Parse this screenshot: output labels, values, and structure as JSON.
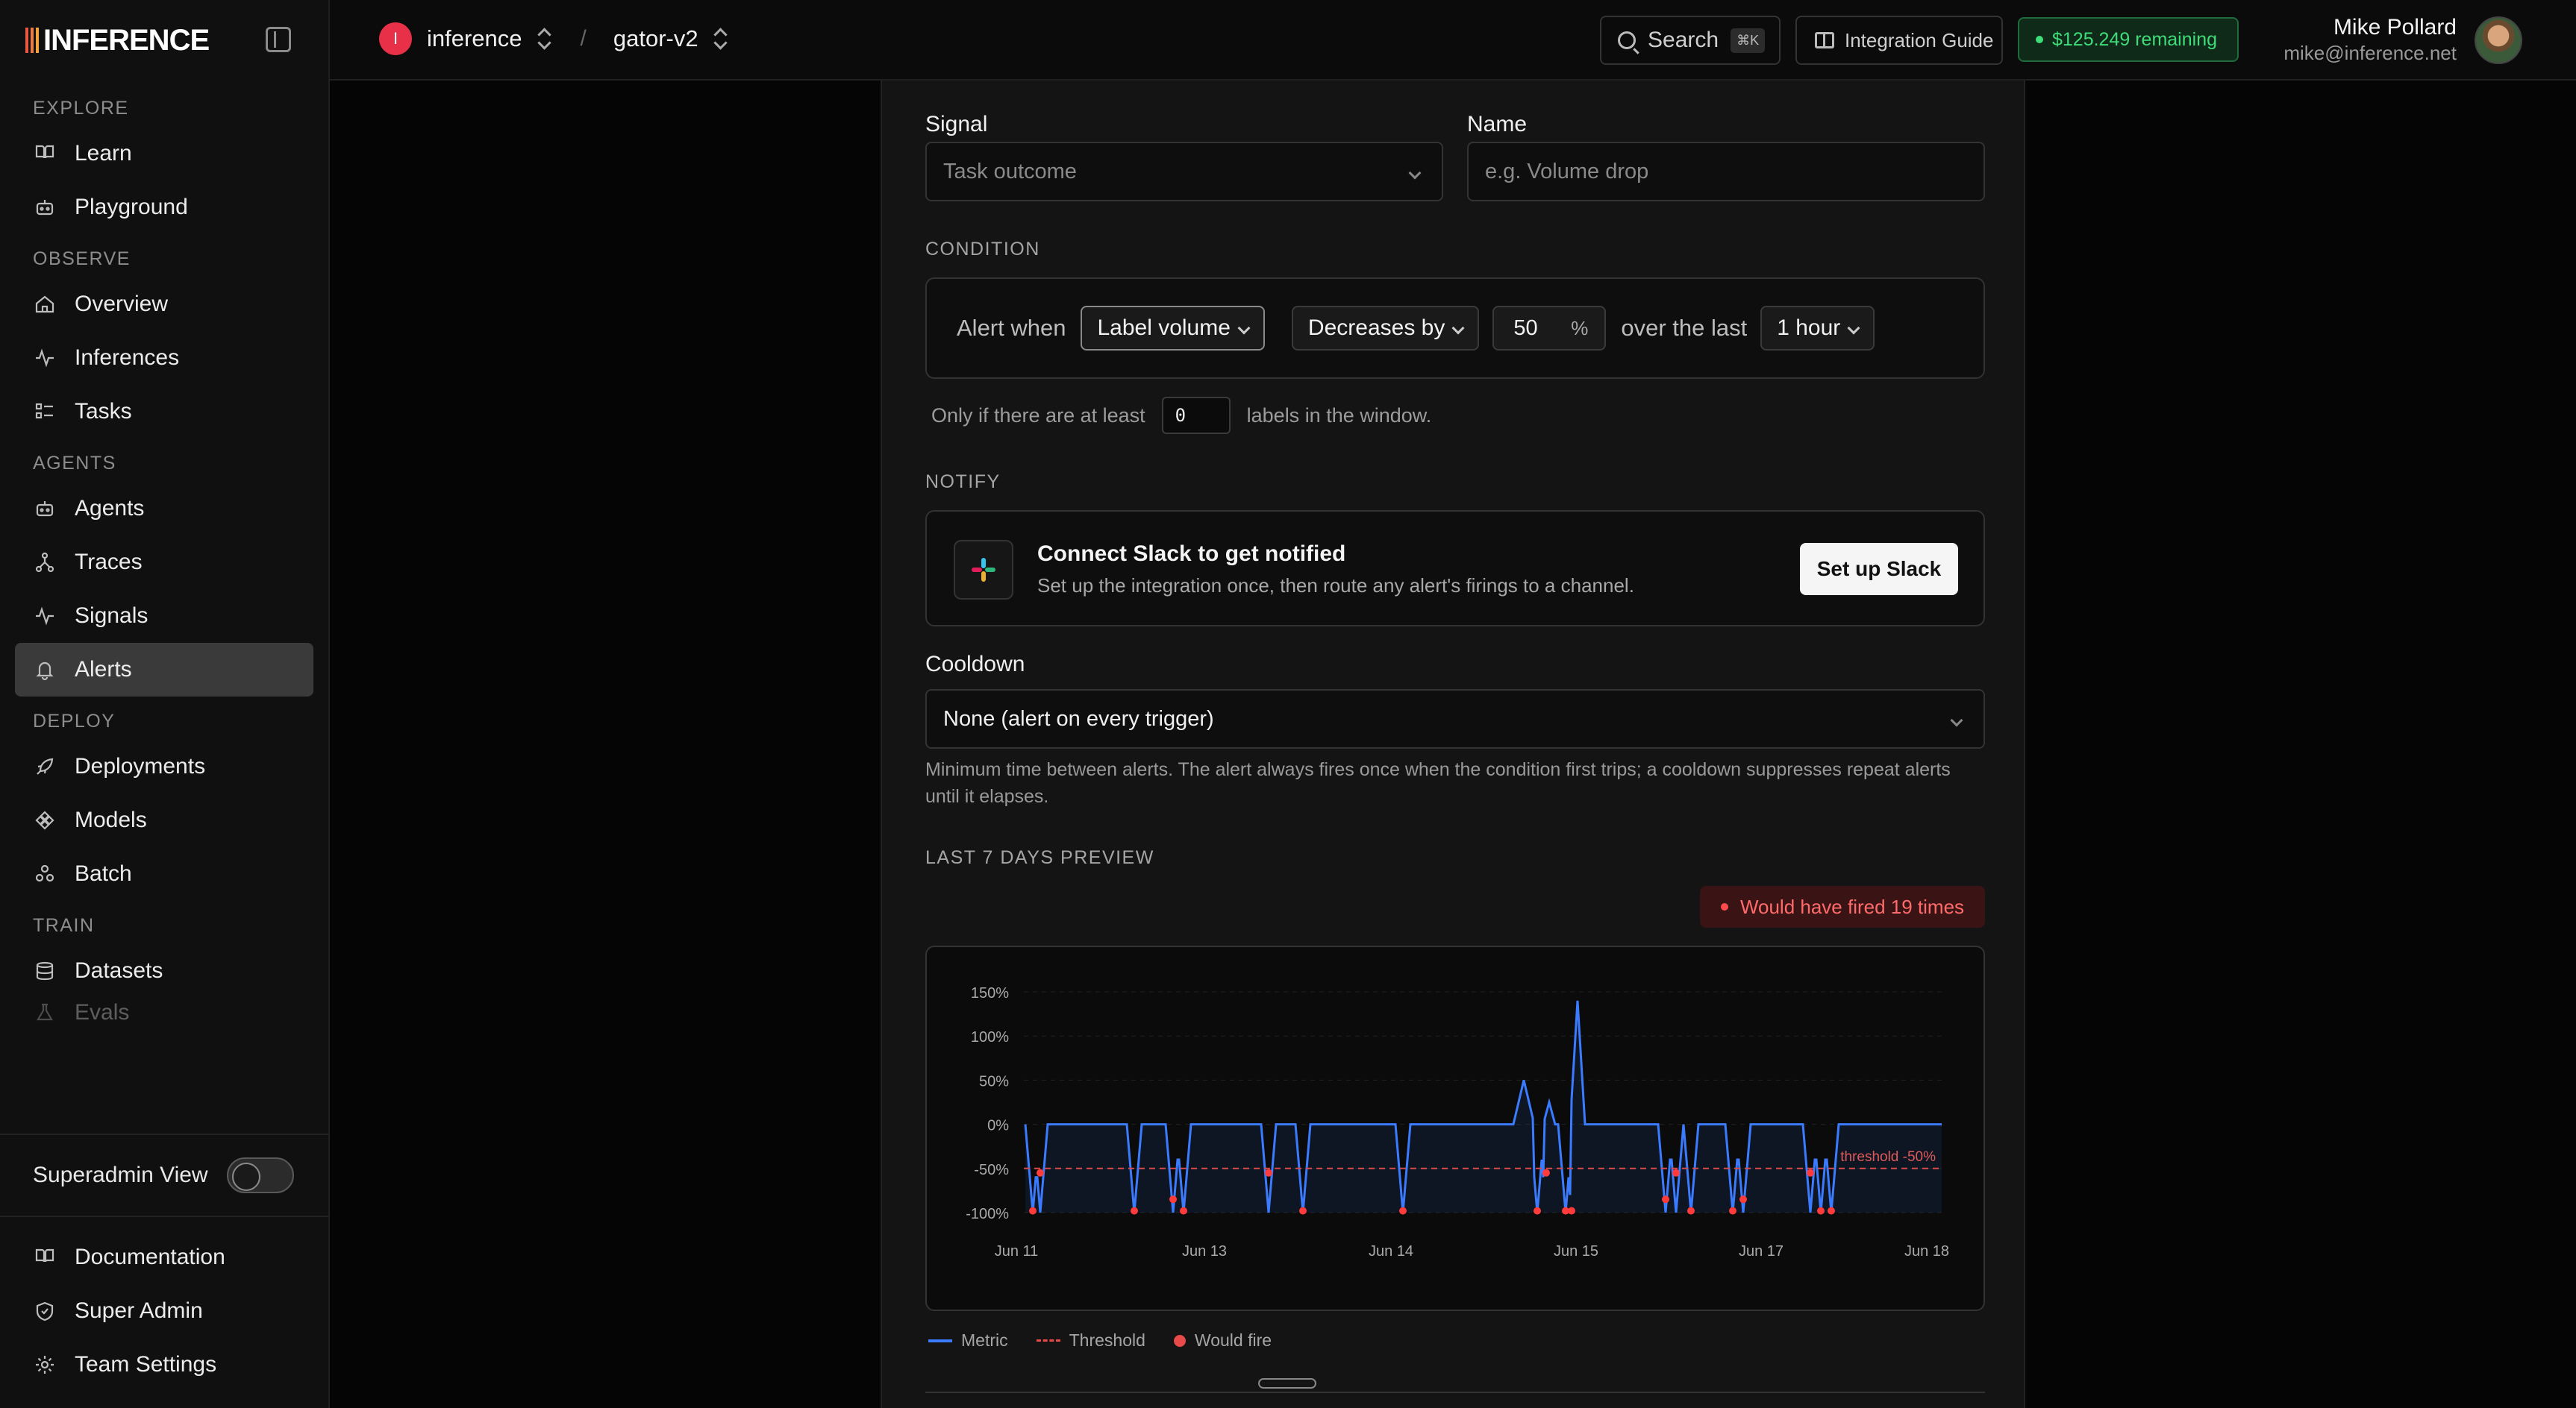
{
  "brand": {
    "name": "INFERENCE"
  },
  "sidebar": {
    "sections": [
      {
        "title": "EXPLORE",
        "items": [
          {
            "label": "Learn",
            "icon": "book-icon"
          },
          {
            "label": "Playground",
            "icon": "robot-icon"
          }
        ]
      },
      {
        "title": "OBSERVE",
        "items": [
          {
            "label": "Overview",
            "icon": "home-icon"
          },
          {
            "label": "Inferences",
            "icon": "activity-icon"
          },
          {
            "label": "Tasks",
            "icon": "checklist-icon"
          }
        ]
      },
      {
        "title": "AGENTS",
        "items": [
          {
            "label": "Agents",
            "icon": "robot-icon"
          },
          {
            "label": "Traces",
            "icon": "nodes-icon"
          },
          {
            "label": "Signals",
            "icon": "activity-icon"
          },
          {
            "label": "Alerts",
            "icon": "bell-icon",
            "active": true
          }
        ]
      },
      {
        "title": "DEPLOY",
        "items": [
          {
            "label": "Deployments",
            "icon": "rocket-icon"
          },
          {
            "label": "Models",
            "icon": "diamond-icon"
          },
          {
            "label": "Batch",
            "icon": "cluster-icon"
          }
        ]
      },
      {
        "title": "TRAIN",
        "items": [
          {
            "label": "Datasets",
            "icon": "database-icon"
          },
          {
            "label": "Evals",
            "icon": "flask-icon"
          }
        ]
      }
    ],
    "superadmin_label": "Superadmin View",
    "superadmin_on": false,
    "bottom": [
      {
        "label": "Documentation",
        "icon": "book-icon"
      },
      {
        "label": "Super Admin",
        "icon": "shield-icon"
      },
      {
        "label": "Team Settings",
        "icon": "gear-icon"
      }
    ]
  },
  "topbar": {
    "org_initial": "I",
    "org": "inference",
    "sep": "/",
    "project": "gator-v2",
    "search_label": "Search",
    "search_kbd": "⌘K",
    "guide_label": "Integration Guide",
    "credits": "$125.249 remaining",
    "user_name": "Mike Pollard",
    "user_email": "mike@inference.net"
  },
  "form": {
    "signal_label": "Signal",
    "signal_placeholder": "Task outcome",
    "name_label": "Name",
    "name_placeholder": "e.g. Volume drop",
    "condition_title": "CONDITION",
    "alert_when": "Alert when",
    "metric": "Label volume",
    "direction": "Decreases by",
    "amount": "50",
    "unit": "%",
    "over_the_last": "over the last",
    "window": "1 hour",
    "min_prefix": "Only if there are at least",
    "min_value": "0",
    "min_suffix": "labels in the window.",
    "notify_title": "NOTIFY",
    "slack_title": "Connect Slack to get notified",
    "slack_sub": "Set up the integration once, then route any alert's firings to a channel.",
    "slack_button": "Set up Slack",
    "cooldown_label": "Cooldown",
    "cooldown_value": "None (alert on every trigger)",
    "cooldown_help": "Minimum time between alerts. The alert always fires once when the condition first trips; a cooldown suppresses repeat alerts until it elapses.",
    "preview_title": "LAST 7 DAYS PREVIEW",
    "fired_badge": "Would have fired 19 times"
  },
  "chart_data": {
    "type": "line",
    "y_ticks": [
      "150%",
      "100%",
      "50%",
      "0%",
      "-50%",
      "-100%"
    ],
    "ylim": [
      -100,
      150
    ],
    "x_ticks": [
      "Jun 11",
      "Jun 13",
      "Jun 14",
      "Jun 15",
      "Jun 17",
      "Jun 18"
    ],
    "threshold": -50,
    "threshold_label": "threshold -50%",
    "series": [
      {
        "name": "Metric",
        "color": "#3a7bff"
      }
    ],
    "legend": [
      "Metric",
      "Threshold",
      "Would fire"
    ],
    "fire_count": 19
  }
}
